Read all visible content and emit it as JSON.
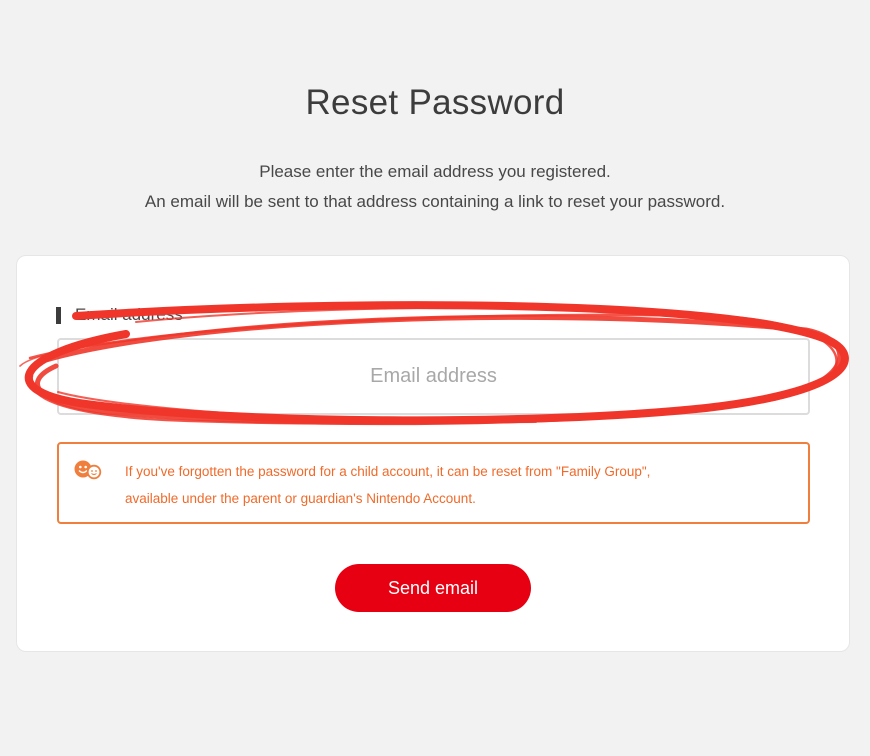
{
  "header": {
    "title": "Reset Password",
    "instruction_line1": "Please enter the email address you registered.",
    "instruction_line2": "An email will be sent to that address containing a link to reset your password."
  },
  "form": {
    "email_label": "Email address",
    "email_placeholder": "Email address",
    "email_value": ""
  },
  "notice": {
    "icon": "family-group-icon",
    "text_line1": "If you've forgotten the password for a child account, it can be reset from \"Family Group\",",
    "text_line2": "available under the parent or guardian's Nintendo Account."
  },
  "actions": {
    "send_label": "Send email"
  },
  "colors": {
    "accent_red": "#e60012",
    "notice_orange": "#f07e3c",
    "highlight_red": "#f0362a"
  }
}
